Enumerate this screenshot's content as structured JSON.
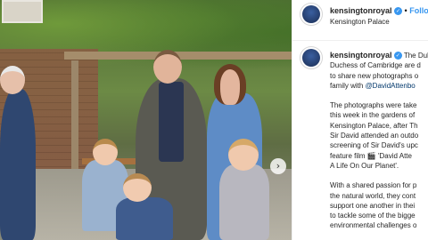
{
  "photo": {
    "next_arrow": "›"
  },
  "post": {
    "username": "kensingtonroyal",
    "verified_mark": "✓",
    "follow_separator": "•",
    "follow_label": "Follow",
    "location": "Kensington Palace",
    "caption": {
      "intro_lines": [
        "The Duk",
        "Duchess of Cambridge are d",
        "to share new photographs o",
        "family with "
      ],
      "intro_mention": "@DavidAttenbo",
      "para2_lines": [
        "The photographs were take",
        "this week in the gardens of",
        "Kensington Palace, after Th",
        "Sir David attended an outdo",
        "screening of Sir David's upc",
        "feature film 🎬 'David Atte",
        "A Life On Our Planet'."
      ],
      "para3_lines": [
        "With a shared passion for p",
        "the natural world, they cont",
        "support one another in thei",
        "to tackle some of the bigge",
        "environmental challenges o"
      ]
    }
  },
  "icons": {
    "avatar": "kensington-royal-avatar",
    "verified": "verified-badge-icon",
    "next": "chevron-right-icon"
  },
  "colors": {
    "link_blue": "#3897f0",
    "mention": "#00376b",
    "text": "#262626"
  }
}
